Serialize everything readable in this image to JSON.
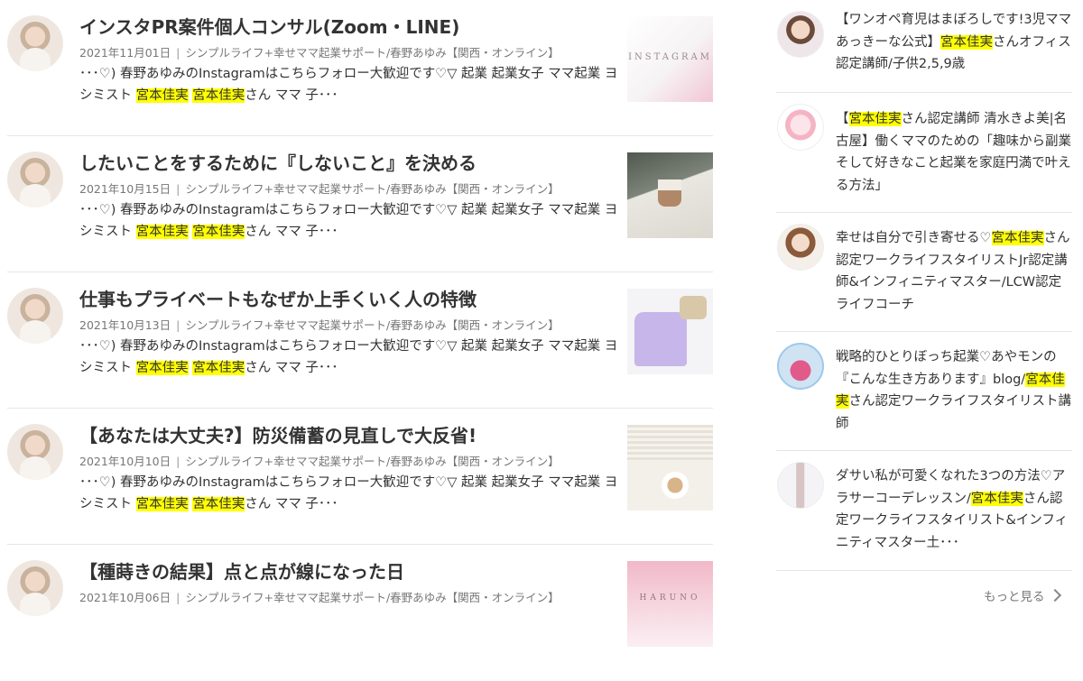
{
  "articles": [
    {
      "title": "インスタPR案件個人コンサル(Zoom・LINE)",
      "date": "2021年11月01日",
      "blog": "シンプルライフ+幸せママ起業サポート/春野あゆみ【関西・オンライン】",
      "excerpt_a": "･･･♡) 春野あゆみのInstagramはこちらフォロー大歓迎です♡▽ 起業 起業女子 ママ起業 ヨシミスト ",
      "hl_1": "宮本佳実",
      "hl_2": "宮本佳実",
      "excerpt_b": "さん ママ 子･･･",
      "thumb_text": "INSTAGRAM"
    },
    {
      "title": "したいことをするために『しないこと』を決める",
      "date": "2021年10月15日",
      "blog": "シンプルライフ+幸せママ起業サポート/春野あゆみ【関西・オンライン】",
      "excerpt_a": "･･･♡) 春野あゆみのInstagramはこちらフォロー大歓迎です♡▽ 起業 起業女子 ママ起業 ヨシミスト ",
      "hl_1": "宮本佳実",
      "hl_2": "宮本佳実",
      "excerpt_b": "さん ママ 子･･･",
      "thumb_text": ""
    },
    {
      "title": "仕事もプライベートもなぜか上手くいく人の特徴",
      "date": "2021年10月13日",
      "blog": "シンプルライフ+幸せママ起業サポート/春野あゆみ【関西・オンライン】",
      "excerpt_a": "･･･♡) 春野あゆみのInstagramはこちらフォロー大歓迎です♡▽ 起業 起業女子 ママ起業 ヨシミスト ",
      "hl_1": "宮本佳実",
      "hl_2": "宮本佳実",
      "excerpt_b": "さん ママ 子･･･",
      "thumb_text": ""
    },
    {
      "title": "【あなたは大丈夫?】防災備蓄の見直しで大反省!",
      "date": "2021年10月10日",
      "blog": "シンプルライフ+幸せママ起業サポート/春野あゆみ【関西・オンライン】",
      "excerpt_a": "･･･♡) 春野あゆみのInstagramはこちらフォロー大歓迎です♡▽ 起業 起業女子 ママ起業 ヨシミスト ",
      "hl_1": "宮本佳実",
      "hl_2": "宮本佳実",
      "excerpt_b": "さん ママ 子･･･",
      "thumb_text": ""
    },
    {
      "title": "【種蒔きの結果】点と点が線になった日",
      "date": "2021年10月06日",
      "blog": "シンプルライフ+幸せママ起業サポート/春野あゆみ【関西・オンライン】",
      "excerpt_a": "",
      "hl_1": "",
      "hl_2": "",
      "excerpt_b": "",
      "thumb_text": "HARUNO"
    }
  ],
  "sidebar": {
    "items": [
      {
        "pre": "【ワンオペ育児はまぼろしです!3児ママあっきーな公式】",
        "hl": "宮本佳実",
        "post": "さんオフィス認定講師/子供2,5,9歳"
      },
      {
        "pre": "【",
        "hl": "宮本佳実",
        "post": "さん認定講師 清水きよ美|名古屋】働くママのための「趣味から副業そして好きなこと起業を家庭円満で叶える方法」"
      },
      {
        "pre": "幸せは自分で引き寄せる♡",
        "hl": "宮本佳実",
        "post": "さん認定ワークライフスタイリストJr認定講師&インフィニティマスター/LCW認定ライフコーチ"
      },
      {
        "pre": "戦略的ひとりぼっち起業♡あやモンの『こんな生き方あります』blog/",
        "hl": "宮本佳実",
        "post": "さん認定ワークライフスタイリスト講師"
      },
      {
        "pre": "ダサい私が可愛くなれた3つの方法♡アラサーコーデレッスン/",
        "hl": "宮本佳実",
        "post": "さん認定ワークライフスタイリスト&インフィニティマスター土･･･"
      }
    ],
    "more_label": "もっと見る"
  }
}
